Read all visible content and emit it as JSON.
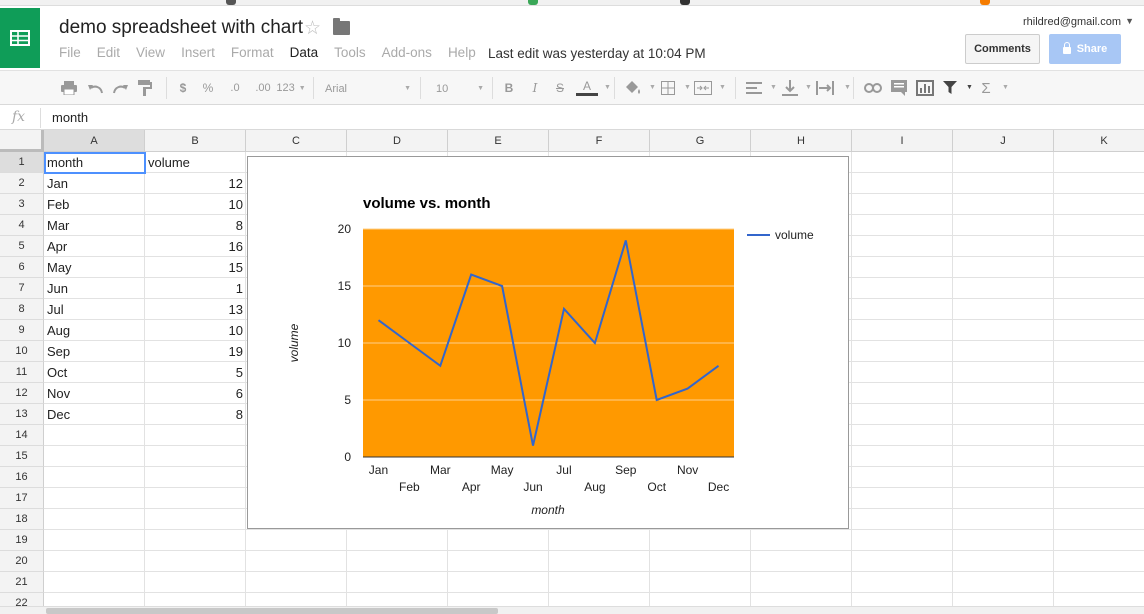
{
  "header": {
    "doc_title": "demo spreadsheet with chart",
    "last_edit": "Last edit was yesterday at 10:04 PM",
    "user_email": "rhildred@gmail.com",
    "comments_label": "Comments",
    "share_label": "Share"
  },
  "menu": [
    "File",
    "Edit",
    "View",
    "Insert",
    "Format",
    "Data",
    "Tools",
    "Add-ons",
    "Help"
  ],
  "menu_active": "Data",
  "toolbar": {
    "currency": "$",
    "percent": "%",
    "dec_less": ".0",
    "dec_more": ".00",
    "more_formats": "123",
    "font": "Arial",
    "font_size": "10",
    "bold": "B",
    "italic": "I",
    "strike": "S",
    "text_color": "A",
    "sum": "Σ"
  },
  "formula_bar": {
    "fx": "fx",
    "value": "month"
  },
  "columns": [
    "A",
    "B",
    "C",
    "D",
    "E",
    "F",
    "G",
    "H",
    "I",
    "J",
    "K"
  ],
  "rows": [
    "1",
    "2",
    "3",
    "4",
    "5",
    "6",
    "7",
    "8",
    "9",
    "10",
    "11",
    "12",
    "13",
    "14",
    "15",
    "16",
    "17",
    "18",
    "19",
    "20",
    "21",
    "22"
  ],
  "cells": {
    "header": {
      "a": "month",
      "b": "volume"
    },
    "data": [
      {
        "a": "Jan",
        "b": "12"
      },
      {
        "a": "Feb",
        "b": "10"
      },
      {
        "a": "Mar",
        "b": "8"
      },
      {
        "a": "Apr",
        "b": "16"
      },
      {
        "a": "May",
        "b": "15"
      },
      {
        "a": "Jun",
        "b": "1"
      },
      {
        "a": "Jul",
        "b": "13"
      },
      {
        "a": "Aug",
        "b": "10"
      },
      {
        "a": "Sep",
        "b": "19"
      },
      {
        "a": "Oct",
        "b": "5"
      },
      {
        "a": "Nov",
        "b": "6"
      },
      {
        "a": "Dec",
        "b": "8"
      }
    ]
  },
  "colors": {
    "plot_bg": "#ff9900",
    "series_line": "#3366cc",
    "brand": "#0f9d58",
    "selection": "#4d90fe"
  },
  "chart_data": {
    "type": "line",
    "title": "volume vs. month",
    "xlabel": "month",
    "ylabel": "volume",
    "categories": [
      "Jan",
      "Feb",
      "Mar",
      "Apr",
      "May",
      "Jun",
      "Jul",
      "Aug",
      "Sep",
      "Oct",
      "Nov",
      "Dec"
    ],
    "series": [
      {
        "name": "volume",
        "values": [
          12,
          10,
          8,
          16,
          15,
          1,
          13,
          10,
          19,
          5,
          6,
          8
        ]
      }
    ],
    "ylim": [
      0,
      20
    ],
    "yticks": [
      "0",
      "5",
      "10",
      "15",
      "20"
    ],
    "grid": true,
    "legend": "right"
  }
}
